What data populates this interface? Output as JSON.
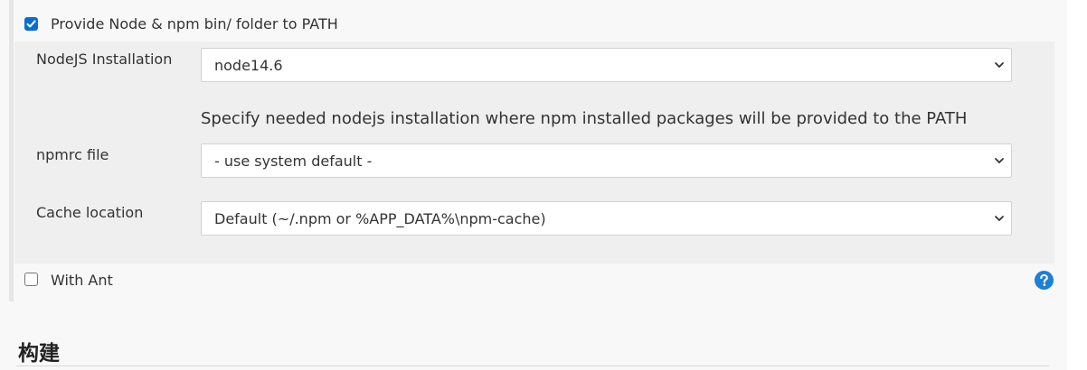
{
  "options": {
    "provide_path": {
      "label": "Provide Node & npm bin/ folder to PATH",
      "checked": true
    },
    "with_ant": {
      "label": "With Ant",
      "checked": false
    }
  },
  "nodejs": {
    "label": "NodeJS Installation",
    "value": "node14.6",
    "help": "Specify needed nodejs installation where npm installed packages will be provided to the PATH"
  },
  "npmrc": {
    "label": "npmrc file",
    "value": "- use system default -"
  },
  "cache": {
    "label": "Cache location",
    "value": "Default (~/.npm or %APP_DATA%\\npm-cache)"
  },
  "icons": {
    "help": "help-icon",
    "dropdown": "chevron-down-icon",
    "check": "checkmark-icon"
  },
  "colors": {
    "accent": "#0a6ed1",
    "help_icon": "#1d7fd6",
    "panel": "#efefef",
    "page": "#f8f8f8"
  },
  "section": {
    "title": "构建"
  }
}
